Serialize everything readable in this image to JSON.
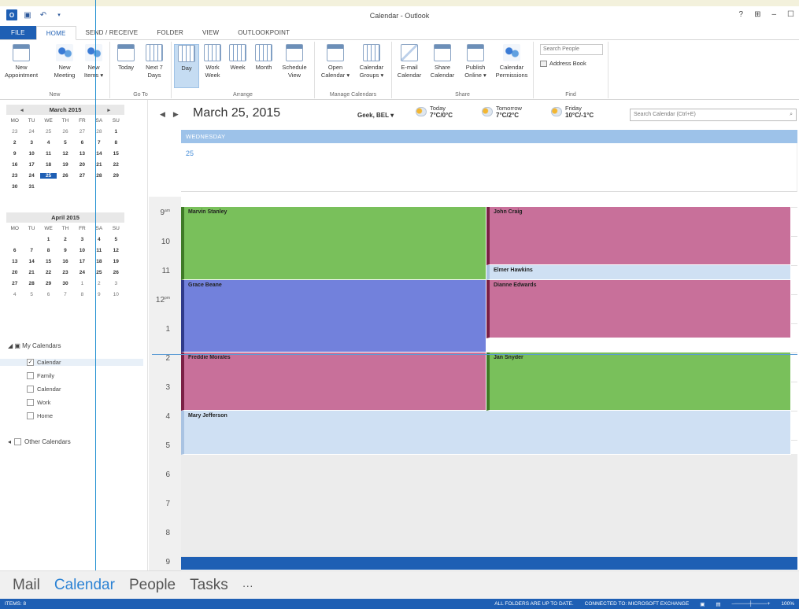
{
  "window": {
    "title": "Calendar - Outlook",
    "controls": [
      "?",
      "⊞",
      "–",
      "☐"
    ]
  },
  "quick_access": [
    "outlook-logo",
    "save-icon",
    "undo-icon",
    "dropdown-icon"
  ],
  "tabs": [
    "FILE",
    "HOME",
    "SEND / RECEIVE",
    "FOLDER",
    "VIEW",
    "OUTLOOKPOINT"
  ],
  "active_tab": "HOME",
  "ribbon": {
    "groups": [
      "New",
      "Go To",
      "Arrange",
      "Manage Calendars",
      "Share",
      "Find"
    ],
    "new": [
      "New Appointment",
      "New Meeting",
      "New Items ▾"
    ],
    "goto": [
      "Today",
      "Next 7 Days"
    ],
    "arrange": [
      "Day",
      "Work Week",
      "Week",
      "Month",
      "Schedule View"
    ],
    "manage": [
      "Open Calendar ▾",
      "Calendar Groups ▾"
    ],
    "share": [
      "E-mail Calendar",
      "Share Calendar",
      "Publish Online ▾",
      "Calendar Permissions"
    ],
    "search_people_placeholder": "Search People",
    "address_book": "Address Book"
  },
  "mini_calendars": [
    {
      "title": "March 2015",
      "dow": [
        "MO",
        "TU",
        "WE",
        "TH",
        "FR",
        "SA",
        "SU"
      ],
      "weeks": [
        [
          "23",
          "24",
          "25",
          "26",
          "27",
          "28",
          "1"
        ],
        [
          "2",
          "3",
          "4",
          "5",
          "6",
          "7",
          "8"
        ],
        [
          "9",
          "10",
          "11",
          "12",
          "13",
          "14",
          "15"
        ],
        [
          "16",
          "17",
          "18",
          "19",
          "20",
          "21",
          "22"
        ],
        [
          "23",
          "24",
          "25",
          "26",
          "27",
          "28",
          "29"
        ],
        [
          "30",
          "31",
          "",
          "",
          "",
          "",
          ""
        ]
      ],
      "today": "25"
    },
    {
      "title": "April 2015",
      "dow": [
        "MO",
        "TU",
        "WE",
        "TH",
        "FR",
        "SA",
        "SU"
      ],
      "weeks": [
        [
          "",
          "",
          "1",
          "2",
          "3",
          "4",
          "5"
        ],
        [
          "6",
          "7",
          "8",
          "9",
          "10",
          "11",
          "12"
        ],
        [
          "13",
          "14",
          "15",
          "16",
          "17",
          "18",
          "19"
        ],
        [
          "20",
          "21",
          "22",
          "23",
          "24",
          "25",
          "26"
        ],
        [
          "27",
          "28",
          "29",
          "30",
          "1",
          "2",
          "3"
        ],
        [
          "4",
          "5",
          "6",
          "7",
          "8",
          "9",
          "10"
        ]
      ]
    }
  ],
  "my_calendars": {
    "label": "My Calendars",
    "items": [
      "Calendar",
      "Family",
      "Calendar",
      "Work",
      "Home"
    ],
    "checked": "Calendar"
  },
  "other_calendars": "Other Calendars",
  "calendar_view": {
    "date_title": "March 25, 2015",
    "location": "Geek, BEL ▾",
    "weather": [
      {
        "day": "Today",
        "temp": "7°C/0°C"
      },
      {
        "day": "Tomorrow",
        "temp": "7°C/2°C"
      },
      {
        "day": "Friday",
        "temp": "10°C/-1°C"
      }
    ],
    "search_placeholder": "Search Calendar (Ctrl+E)",
    "day_header": "WEDNESDAY",
    "day_number": "25",
    "hours": [
      "9",
      "10",
      "11",
      "12",
      "1",
      "2",
      "3",
      "4",
      "5",
      "6",
      "7",
      "8",
      "9"
    ],
    "hour_suffix": {
      "9": "am",
      "12": "pm"
    }
  },
  "appointments": [
    {
      "name": "Marvin Stanley",
      "start": 9,
      "end": 11.5,
      "col": "left",
      "color": "#79c05b"
    },
    {
      "name": "John Craig",
      "start": 9,
      "end": 11,
      "col": "right",
      "color": "#c8709a"
    },
    {
      "name": "Elmer Hawkins",
      "start": 11,
      "end": 11.5,
      "col": "right",
      "color": "#cfe0f3"
    },
    {
      "name": "Grace Beane",
      "start": 11.5,
      "end": 14,
      "col": "left",
      "color": "#7281dc"
    },
    {
      "name": "Dianne Edwards",
      "start": 11.5,
      "end": 13.5,
      "col": "right",
      "color": "#c8709a"
    },
    {
      "name": "Freddie Morales",
      "start": 14,
      "end": 16,
      "col": "left",
      "color": "#c8709a"
    },
    {
      "name": "Jan Snyder",
      "start": 14,
      "end": 16,
      "col": "right",
      "color": "#79c05b"
    },
    {
      "name": "Mary Jefferson",
      "start": 16,
      "end": 17.5,
      "col": "full",
      "color": "#cfe0f3"
    }
  ],
  "navigation": [
    "Mail",
    "Calendar",
    "People",
    "Tasks",
    "···"
  ],
  "active_nav": "Calendar",
  "status": {
    "items": "ITEMS: 8",
    "sync": "ALL FOLDERS ARE UP TO DATE.",
    "connection": "CONNECTED TO: MICROSOFT EXCHANGE",
    "zoom": "100%"
  }
}
